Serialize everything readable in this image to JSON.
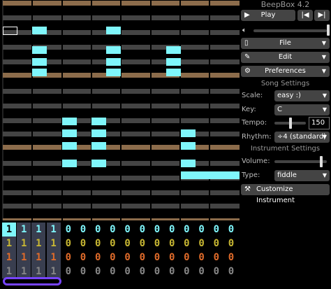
{
  "app": {
    "version": "BeepBox 4.2"
  },
  "transport": {
    "play_label": "Play",
    "prev_icon": "skip-back-icon",
    "next_icon": "skip-forward-icon"
  },
  "menus": {
    "file_label": "File",
    "edit_label": "Edit",
    "preferences_label": "Preferences"
  },
  "song_settings": {
    "heading": "Song Settings",
    "scale_label": "Scale:",
    "scale_value": "easy :)",
    "key_label": "Key:",
    "key_value": "C",
    "tempo_label": "Tempo:",
    "tempo_value": "150",
    "rhythm_label": "Rhythm:",
    "rhythm_value": "÷4 (standard)"
  },
  "instrument_settings": {
    "heading": "Instrument Settings",
    "volume_label": "Volume:",
    "type_label": "Type:",
    "type_value": "fiddle",
    "customize_label": "Customize Instrument"
  },
  "pattern_grid": {
    "rows": [
      [
        "1",
        "1",
        "1",
        "1",
        "0",
        "0",
        "0",
        "0",
        "0",
        "0",
        "0",
        "0",
        "0",
        "0",
        "0",
        "0"
      ],
      [
        "1",
        "1",
        "1",
        "1",
        "0",
        "0",
        "0",
        "0",
        "0",
        "0",
        "0",
        "0",
        "0",
        "0",
        "0",
        "0"
      ],
      [
        "1",
        "1",
        "1",
        "1",
        "0",
        "0",
        "0",
        "0",
        "0",
        "0",
        "0",
        "0",
        "0",
        "0",
        "0",
        "0"
      ],
      [
        "1",
        "1",
        "1",
        "1",
        "0",
        "0",
        "0",
        "0",
        "0",
        "0",
        "0",
        "0",
        "0",
        "0",
        "0",
        "0"
      ]
    ],
    "row_colors": [
      "#7ff6fb",
      "#c9b833",
      "#e06b2a",
      "#888888"
    ]
  },
  "colors": {
    "note": "#7ff6fb",
    "accent": "#7744ff",
    "tonic_row": "#8c6c4b",
    "row": "#444444"
  }
}
